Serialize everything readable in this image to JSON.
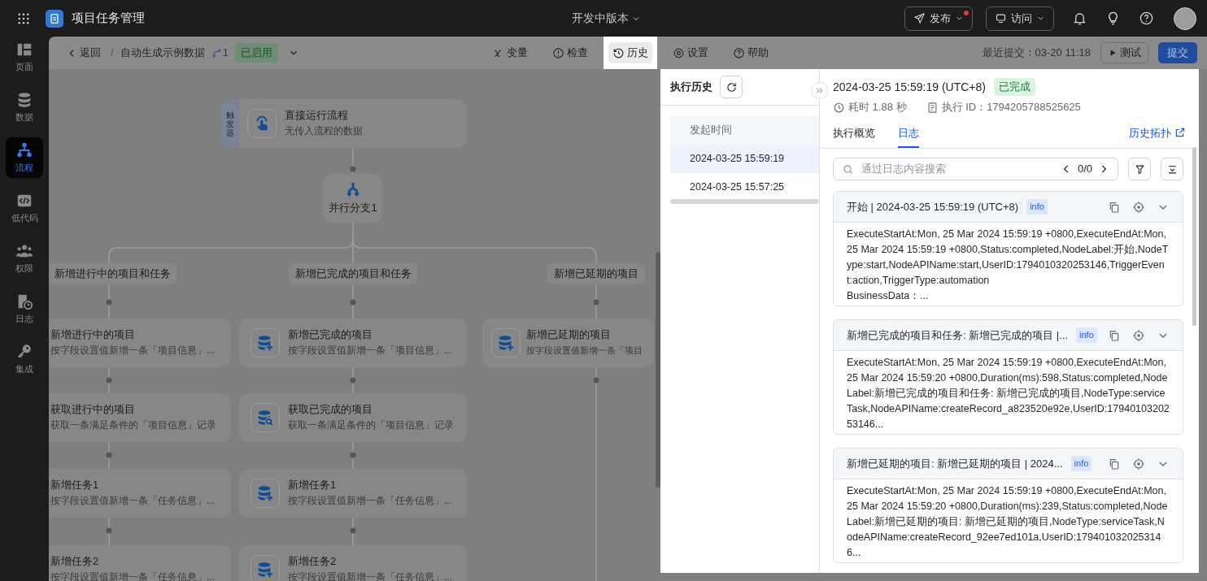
{
  "top_bar": {
    "app_title": "项目任务管理",
    "version": "开发中版本",
    "actions": [
      {
        "label": "发布",
        "notification_dot": true
      },
      {
        "label": "访问",
        "notification_dot": false
      }
    ]
  },
  "sidebar": {
    "items": [
      {
        "label": "页面",
        "selected": false
      },
      {
        "label": "数据",
        "selected": false
      },
      {
        "label": "流程",
        "selected": true
      },
      {
        "label": "低代码",
        "selected": false
      },
      {
        "label": "权限",
        "selected": false
      },
      {
        "label": "日志",
        "selected": false
      },
      {
        "label": "集成",
        "selected": false
      }
    ]
  },
  "toolbar": {
    "back": "返回",
    "separator": "/",
    "flow_name": "自动生成示例数据",
    "version_count": "1",
    "status": "已启用",
    "actions": [
      {
        "label": "变量",
        "selected": false
      },
      {
        "label": "检查",
        "selected": false
      },
      {
        "label": "历史",
        "selected": true
      },
      {
        "label": "设置",
        "selected": false
      },
      {
        "label": "帮助",
        "selected": false
      }
    ],
    "last_commit": "最近提交：03-20 11:18",
    "test_button": "测试",
    "submit_button": "提交"
  },
  "canvas": {
    "trigger": {
      "tag": "触发器",
      "title": "直接运行流程",
      "subtitle": "无传入流程的数据"
    },
    "branch_node": {
      "label": "并行分支1"
    },
    "branches": [
      {
        "label": "新增进行中的项目和任务",
        "nodes": [
          {
            "title": "新增进行中的项目",
            "subtitle": "按字段设置值新增一条「项目信息」..."
          },
          {
            "title": "获取进行中的项目",
            "subtitle": "获取一条满足条件的「项目信息」记录"
          },
          {
            "title": "新增任务1",
            "subtitle": "按字段设置值新增一条「任务信息」..."
          },
          {
            "title": "新增任务2",
            "subtitle": "按字段设置值新增一条「任务信息」..."
          }
        ]
      },
      {
        "label": "新增已完成的项目和任务",
        "nodes": [
          {
            "kind": "create",
            "title": "新增已完成的项目",
            "subtitle": "按字段设置值新增一条「项目信息」..."
          },
          {
            "kind": "query",
            "title": "获取已完成的项目",
            "subtitle": "获取一条满足条件的「项目信息」记录"
          },
          {
            "kind": "create",
            "title": "新增任务1",
            "subtitle": "按字段设置值新增一条「任务信息」..."
          },
          {
            "kind": "create",
            "title": "新增任务2",
            "subtitle": "按字段设置值新增一条「任务信息」..."
          }
        ]
      },
      {
        "label": "新增已延期的项目",
        "nodes": [
          {
            "kind": "create",
            "title": "新增已延期的项目",
            "subtitle": "按字段设置值新增一条「项目"
          }
        ]
      }
    ]
  },
  "history": {
    "title": "执行历史",
    "columns": [
      "发起时间"
    ],
    "rows": [
      {
        "time": "2024-03-25 15:59:19",
        "selected": true
      },
      {
        "time": "2024-03-25 15:57:25",
        "selected": false
      }
    ]
  },
  "detail": {
    "time": "2024-03-25 15:59:19 (UTC+8)",
    "status": "已完成",
    "duration": "耗时 1.88 秒",
    "execution_id": "执行 ID：1794205788525625",
    "tabs": [
      {
        "label": "执行概览",
        "selected": false
      },
      {
        "label": "日志",
        "selected": true
      }
    ],
    "topology_link": "历史拓扑",
    "search": {
      "placeholder": "通过日志内容搜索",
      "count": "0/0"
    },
    "logs": [
      {
        "title": "开始 | 2024-03-25 15:59:19 (UTC+8)",
        "tag": "info",
        "body": "ExecuteStartAt:Mon, 25 Mar 2024 15:59:19 +0800,ExecuteEndAt:Mon, 25 Mar 2024 15:59:19 +0800,Status:completed,NodeLabel:开始,NodeType:start,NodeAPIName:start,UserID:1794010320253146,TriggerEvent:action,TriggerType:automation\nBusinessData：..."
      },
      {
        "title": "新增已完成的项目和任务: 新增已完成的项目 |...",
        "tag": "info",
        "body": "ExecuteStartAt:Mon, 25 Mar 2024 15:59:19 +0800,ExecuteEndAt:Mon, 25 Mar 2024 15:59:20 +0800,Duration(ms):598,Status:completed,NodeLabel:新增已完成的项目和任务: 新增已完成的项目,NodeType:serviceTask,NodeAPIName:createRecord_a823520e92e,UserID:1794010320253146..."
      },
      {
        "title": "新增已延期的项目: 新增已延期的项目 | 2024...",
        "tag": "info",
        "body": "ExecuteStartAt:Mon, 25 Mar 2024 15:59:19 +0800,ExecuteEndAt:Mon, 25 Mar 2024 15:59:20 +0800,Duration(ms):239,Status:completed,NodeLabel:新增已延期的项目: 新增已延期的项目,NodeType:serviceTask,NodeAPIName:createRecord_92ee7ed101a,UserID:1794010320253146..."
      }
    ]
  }
}
